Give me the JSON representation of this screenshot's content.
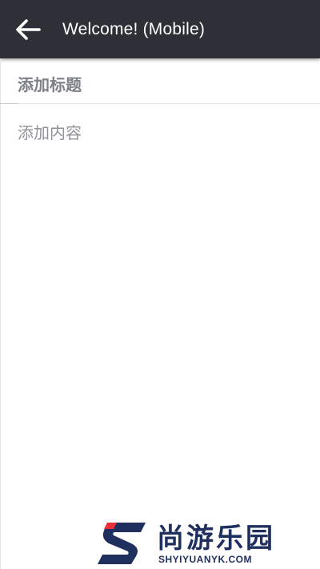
{
  "appbar": {
    "title": "Welcome! (Mobile)",
    "back_icon": "arrow-left-icon",
    "background": "#2d3036",
    "text_color": "#ffffff"
  },
  "editor": {
    "title_placeholder": "添加标题",
    "content_placeholder": "添加内容"
  },
  "watermark": {
    "brand_cn": "尚游乐园",
    "brand_en": "SHYIYUANYK.COM",
    "logo_icon": "s-logo-icon",
    "color": "#1f2f5e",
    "accent": "#e8303a"
  }
}
